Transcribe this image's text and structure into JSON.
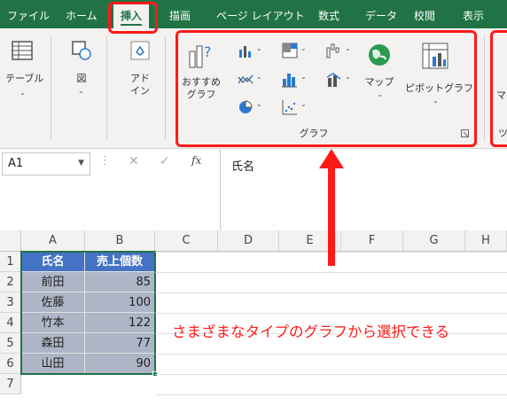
{
  "ribbon_tabs": [
    "ファイル",
    "ホーム",
    "挿入",
    "描画",
    "ページ レイアウト",
    "数式",
    "データ",
    "校閲",
    "表示"
  ],
  "active_tab": "挿入",
  "ribbon": {
    "table_label": "テーブル",
    "illustrations_label": "図",
    "addins_label_line1": "アド",
    "addins_label_line2": "イン",
    "recommended_charts_line1": "おすすめ",
    "recommended_charts_line2": "グラフ",
    "map_label": "マップ",
    "pivotchart_label": "ピボットグラフ",
    "chart_group_label": "グラフ",
    "cut_off_right_label_1": "マ",
    "cut_off_right_label_2": "ツ"
  },
  "formula_bar": {
    "name_box": "A1",
    "fx_label": "fx",
    "content": "氏名"
  },
  "sheet": {
    "columns": [
      "A",
      "B",
      "C",
      "D",
      "E",
      "F",
      "G",
      "H"
    ],
    "rows": [
      "1",
      "2",
      "3",
      "4",
      "5",
      "6",
      "7"
    ],
    "header": [
      "氏名",
      "売上個数"
    ],
    "data": [
      {
        "name": "前田",
        "value": "85"
      },
      {
        "name": "佐藤",
        "value": "100"
      },
      {
        "name": "竹本",
        "value": "122"
      },
      {
        "name": "森田",
        "value": "77"
      },
      {
        "name": "山田",
        "value": "90"
      }
    ]
  },
  "annotation": "さまざまなタイプのグラフから選択できる",
  "colors": {
    "ribbon_green": "#217346",
    "highlight_red": "#ff1a1a",
    "table_header_blue": "#4472c4",
    "table_data_gray": "#adb5c7"
  }
}
